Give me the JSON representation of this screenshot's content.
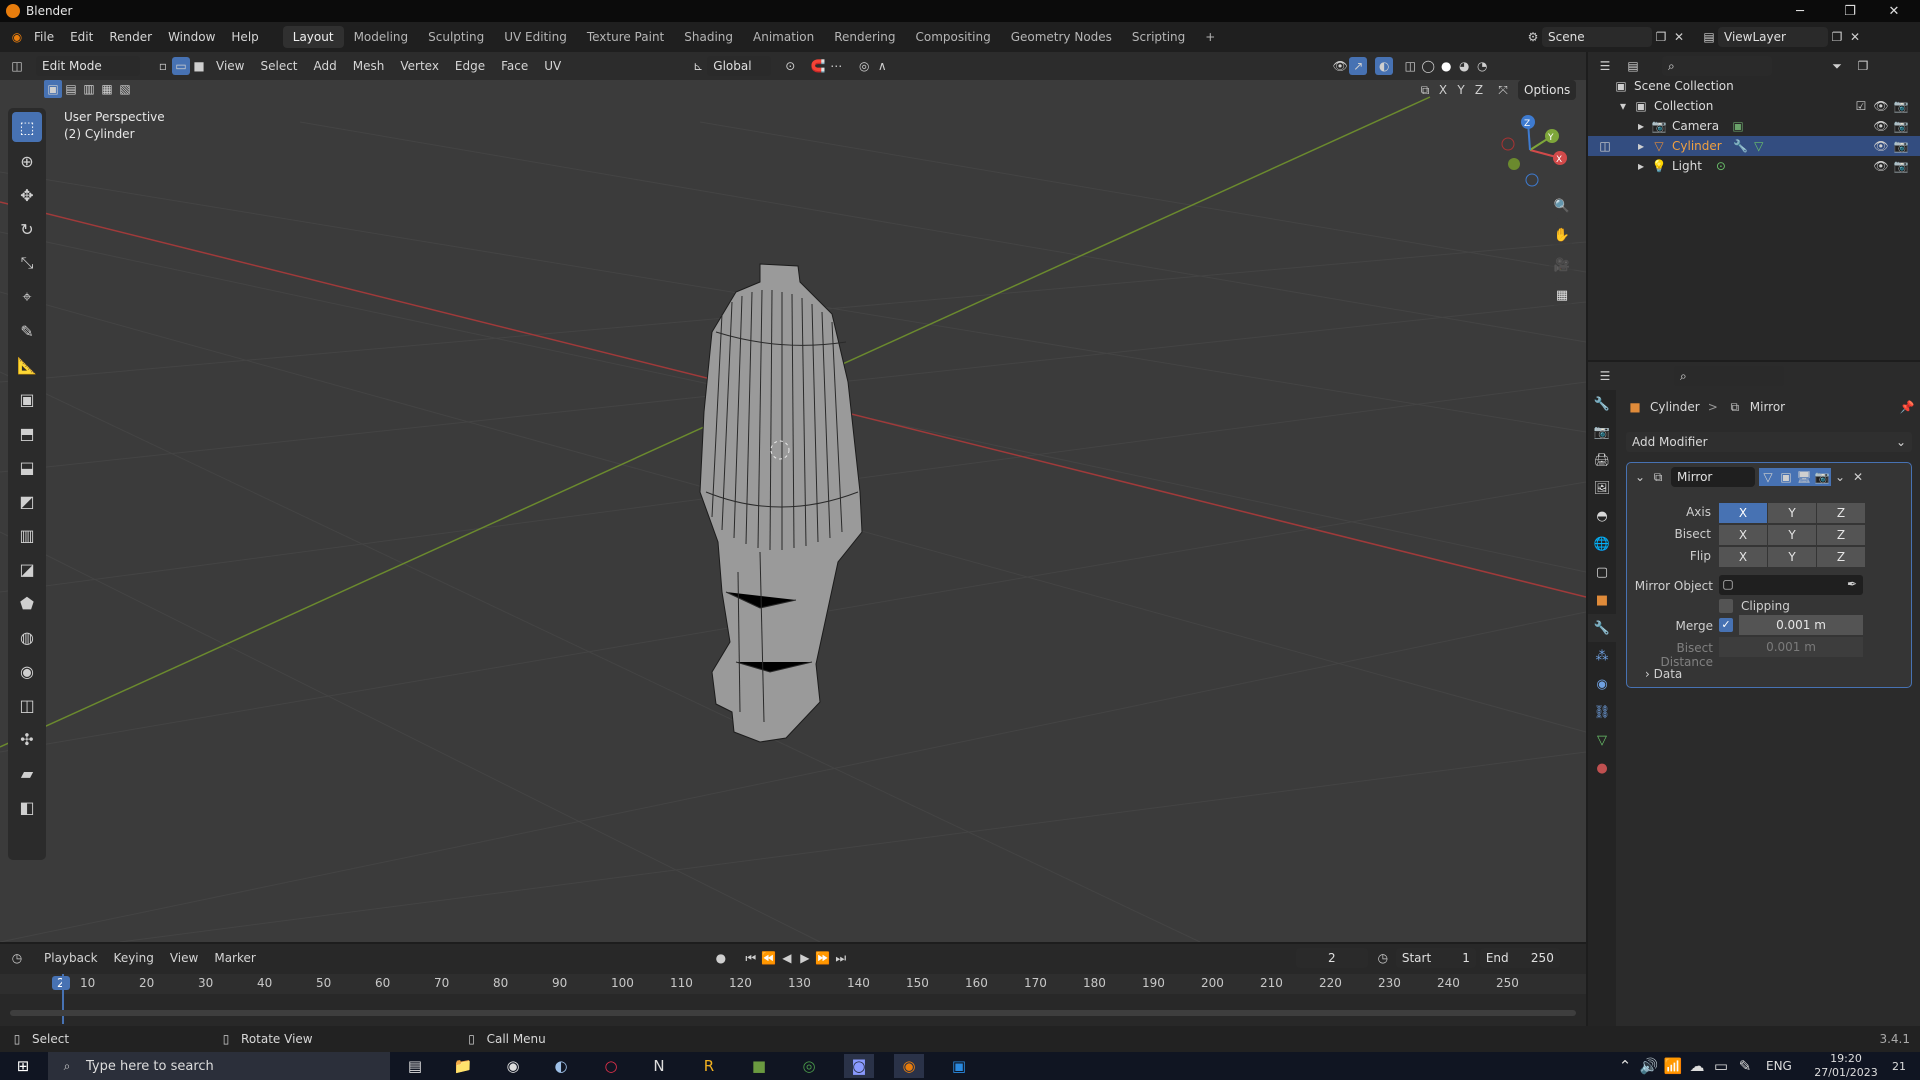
{
  "window": {
    "title": "Blender",
    "min_glyph": "─",
    "max_glyph": "❐",
    "close_glyph": "✕"
  },
  "menus": [
    "File",
    "Edit",
    "Render",
    "Window",
    "Help"
  ],
  "workspaces": [
    "Layout",
    "Modeling",
    "Sculpting",
    "UV Editing",
    "Texture Paint",
    "Shading",
    "Animation",
    "Rendering",
    "Compositing",
    "Geometry Nodes",
    "Scripting",
    "+"
  ],
  "active_workspace": "Layout",
  "scene": {
    "name": "Scene",
    "view_layer": "ViewLayer"
  },
  "viewport": {
    "mode": "Edit Mode",
    "header_menus": [
      "View",
      "Select",
      "Add",
      "Mesh",
      "Vertex",
      "Edge",
      "Face",
      "UV"
    ],
    "orientation": "Global",
    "options": "Options",
    "axes_labels": [
      "X",
      "Y",
      "Z"
    ],
    "overlay_line1": "User Perspective",
    "overlay_line2": "(2) Cylinder",
    "gizmo_axes": {
      "x": "X",
      "y": "Y",
      "z": "Z"
    }
  },
  "outliner": {
    "root": "Scene Collection",
    "collection": "Collection",
    "items": [
      {
        "name": "Camera",
        "selected": false
      },
      {
        "name": "Cylinder",
        "selected": true
      },
      {
        "name": "Light",
        "selected": false
      }
    ]
  },
  "properties": {
    "breadcrumb_object": "Cylinder",
    "breadcrumb_sep": ">",
    "breadcrumb_modifier": "Mirror",
    "add_modifier": "Add Modifier",
    "modifier_name": "Mirror",
    "axis_label": "Axis",
    "bisect_label": "Bisect",
    "flip_label": "Flip",
    "axis_active": "X",
    "axis_buttons": [
      "X",
      "Y",
      "Z"
    ],
    "mirror_object_label": "Mirror Object",
    "clipping_label": "Clipping",
    "clipping_checked": false,
    "merge_label": "Merge",
    "merge_checked": true,
    "merge_value": "0.001 m",
    "bisect_distance_label": "Bisect Distance",
    "bisect_distance_value": "0.001 m",
    "data_label": "Data"
  },
  "timeline": {
    "menus": [
      "Playback",
      "Keying",
      "View",
      "Marker"
    ],
    "current_frame": "2",
    "start_label": "Start",
    "start": "1",
    "end_label": "End",
    "end": "250",
    "ruler": [
      "2",
      "10",
      "20",
      "30",
      "40",
      "50",
      "60",
      "70",
      "80",
      "90",
      "100",
      "110",
      "120",
      "130",
      "140",
      "150",
      "160",
      "170",
      "180",
      "190",
      "200",
      "210",
      "220",
      "230",
      "240",
      "250"
    ]
  },
  "statusbar": {
    "left": "Select",
    "middle": "Rotate View",
    "right": "Call Menu",
    "version": "3.4.1"
  },
  "taskbar": {
    "search_placeholder": "Type here to search",
    "language": "ENG",
    "time": "19:20",
    "date": "27/01/2023",
    "notifications": "21"
  },
  "colors": {
    "accent": "#4772b3",
    "x_axis": "#d24a4a",
    "y_axis": "#7ea63a",
    "z_axis": "#3e7bd0",
    "orange": "#e87d0d"
  }
}
